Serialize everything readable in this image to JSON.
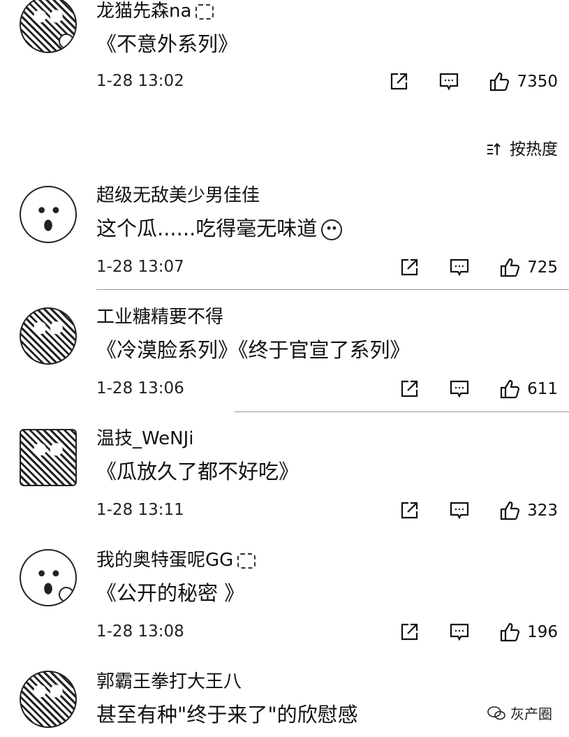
{
  "sort": {
    "label": "按热度",
    "icon": "sort-icon"
  },
  "comments": [
    {
      "username": "龙猫先森na",
      "text": "《不意外系列》",
      "time": "1-28 13:02",
      "likes": "7350",
      "has_badge": true
    },
    {
      "username": "超级无敌美少男佳佳",
      "text": "这个瓜......吃得毫无味道",
      "time": "1-28 13:07",
      "likes": "725",
      "has_emoji": true
    },
    {
      "username": "工业糖精要不得",
      "text": "《冷漠脸系列》《终于官宣了系列》",
      "time": "1-28 13:06",
      "likes": "611"
    },
    {
      "username": "温技_WeNJi",
      "text": "《瓜放久了都不好吃》",
      "time": "1-28 13:11",
      "likes": "323"
    },
    {
      "username": "我的奥特蛋呢GG",
      "text": "《公开的秘密 》",
      "time": "1-28 13:08",
      "likes": "196",
      "has_badge": true
    },
    {
      "username": "郭霸王拳打大王八",
      "text": "甚至有种\"终于来了\"的欣慰感"
    }
  ],
  "watermark": {
    "label": "灰产圈",
    "icon": "wechat-icon"
  },
  "icons": {
    "share": "share-icon",
    "reply": "comment-icon",
    "like": "thumbs-up-icon"
  }
}
